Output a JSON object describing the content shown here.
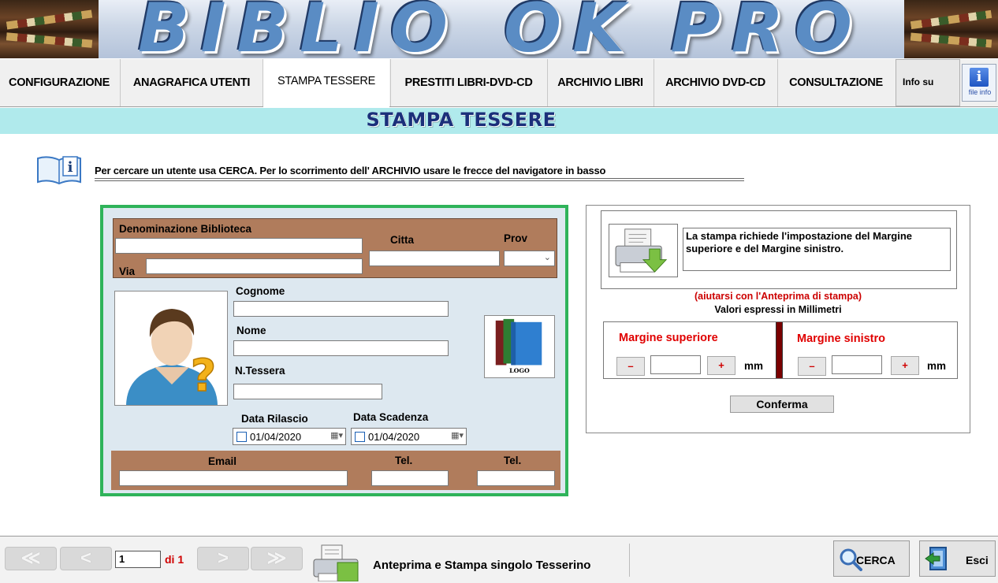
{
  "banner": {
    "title": "BIBLIO_OK PRO"
  },
  "menu": {
    "items": [
      {
        "label": "CONFIGURAZIONE"
      },
      {
        "label": "ANAGRAFICA UTENTI"
      },
      {
        "label": "STAMPA TESSERE",
        "active": true
      },
      {
        "label": "PRESTITI LIBRI-DVD-CD"
      },
      {
        "label": "ARCHIVIO LIBRI"
      },
      {
        "label": "ARCHIVIO DVD-CD"
      },
      {
        "label": "CONSULTAZIONE"
      }
    ],
    "info_label": "Info su",
    "info_button_text": "file info"
  },
  "section": {
    "title": "STAMPA TESSERE"
  },
  "hint": {
    "text": "Per cercare un utente usa CERCA.  Per lo scorrimento dell' ARCHIVIO usare le frecce del  navigatore in basso"
  },
  "card": {
    "library_name_label": "Denominazione Biblioteca",
    "city_label": "Citta",
    "prov_label": "Prov",
    "street_label": "Via",
    "surname_label": "Cognome",
    "name_label": "Nome",
    "card_number_label": "N.Tessera",
    "logo_text": "LOGO",
    "issue_date_label": "Data Rilascio",
    "expiry_date_label": "Data Scadenza",
    "issue_date": "01/04/2020",
    "expiry_date": "01/04/2020",
    "email_label": "Email",
    "tel1_label": "Tel.",
    "tel2_label": "Tel."
  },
  "print_panel": {
    "message": "La stampa richiede l'impostazione del Margine superiore e del Margine sinistro.",
    "preview_hint": "(aiutarsi con l'Anteprima di stampa)",
    "units_note": "Valori espressi in Millimetri",
    "top_margin_label": "Margine superiore",
    "left_margin_label": "Margine sinistro",
    "minus": "–",
    "plus": "+",
    "unit": "mm",
    "confirm_label": "Conferma"
  },
  "footer": {
    "first": "≪",
    "prev": "<",
    "next": ">",
    "last": "≫",
    "page_value": "1",
    "page_of": "di 1",
    "preview_label": "Anteprima e Stampa singolo Tesserino",
    "search_label": "CERCA",
    "exit_label": "Esci"
  },
  "colors": {
    "accent_band": "#b0eaec",
    "card_border": "#2fb35a",
    "card_brown": "#b07c5c",
    "warning_red": "#cc0000"
  }
}
